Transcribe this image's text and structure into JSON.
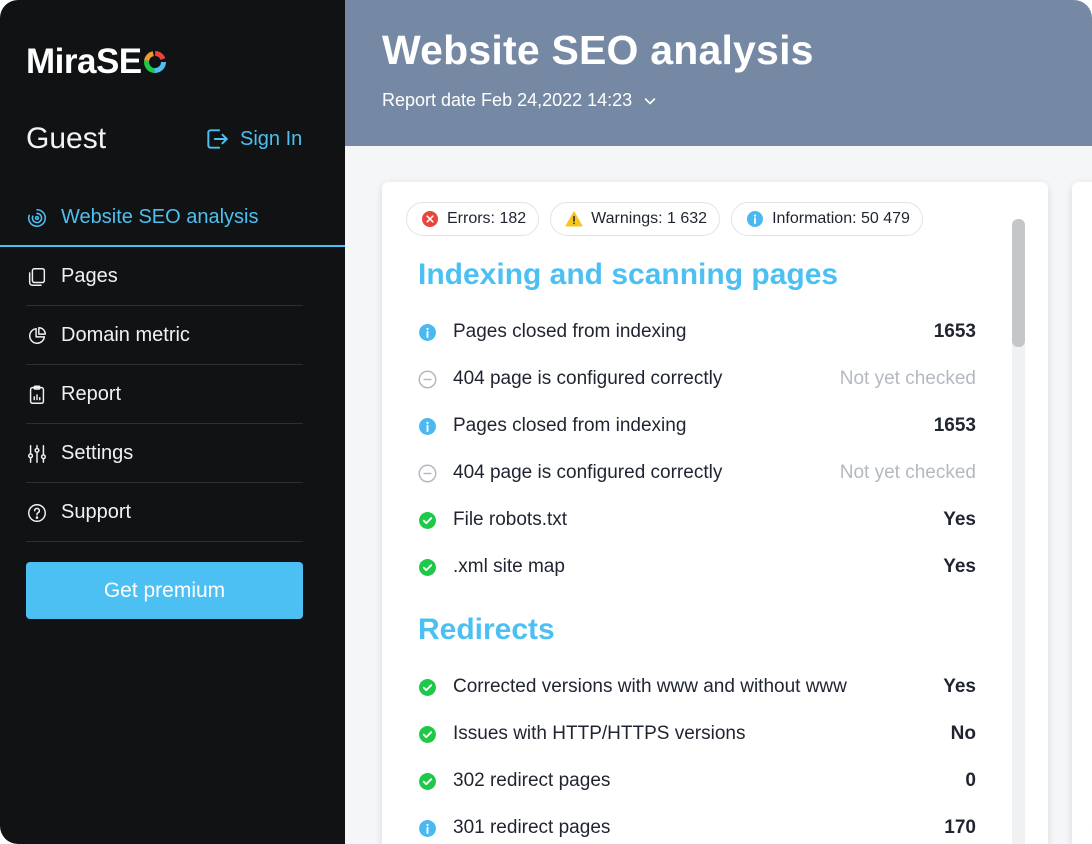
{
  "app": {
    "logo_text": "MiraSE",
    "logo_colors": {
      "blue": "#4cc0f2",
      "green": "#1ec94a",
      "orange": "#f29a2e",
      "red": "#e8453c"
    }
  },
  "user": {
    "name": "Guest",
    "sign_in_label": "Sign In"
  },
  "nav": {
    "items": [
      {
        "label": "Website SEO analysis",
        "icon": "target-icon"
      },
      {
        "label": "Pages",
        "icon": "pages-icon"
      },
      {
        "label": "Domain metric",
        "icon": "pie-chart-icon"
      },
      {
        "label": "Report",
        "icon": "clipboard-icon"
      },
      {
        "label": "Settings",
        "icon": "sliders-icon"
      },
      {
        "label": "Support",
        "icon": "help-icon"
      }
    ],
    "active_index": 0,
    "premium_label": "Get premium"
  },
  "header": {
    "title": "Website SEO analysis",
    "report_date": "Report date Feb 24,2022 14:23"
  },
  "summary": {
    "errors": "Errors: 182",
    "warnings": "Warnings: 1 632",
    "information": "Information: 50 479"
  },
  "sections": [
    {
      "title": "Indexing and scanning pages",
      "rows": [
        {
          "status": "info",
          "label": "Pages closed from indexing",
          "value": "1653"
        },
        {
          "status": "pending",
          "label": "404 page is configured correctly",
          "value": "Not yet checked"
        },
        {
          "status": "info",
          "label": "Pages closed from indexing",
          "value": "1653"
        },
        {
          "status": "pending",
          "label": "404 page is configured correctly",
          "value": "Not yet checked"
        },
        {
          "status": "ok",
          "label": "File robots.txt",
          "value": "Yes"
        },
        {
          "status": "ok",
          "label": ".xml site map",
          "value": "Yes"
        }
      ]
    },
    {
      "title": "Redirects",
      "rows": [
        {
          "status": "ok",
          "label": "Corrected versions with www and without www",
          "value": "Yes"
        },
        {
          "status": "ok",
          "label": "Issues with HTTP/HTTPS versions",
          "value": "No"
        },
        {
          "status": "ok",
          "label": "302 redirect pages",
          "value": "0"
        },
        {
          "status": "info",
          "label": "301 redirect pages",
          "value": "170"
        }
      ]
    }
  ],
  "colors": {
    "accent": "#4cc0f2",
    "header_bg": "#7589a5",
    "sidebar_bg": "#111213",
    "ok": "#1ec94a",
    "error": "#e8453c",
    "warning": "#f7c520",
    "info": "#4cb8f2"
  }
}
